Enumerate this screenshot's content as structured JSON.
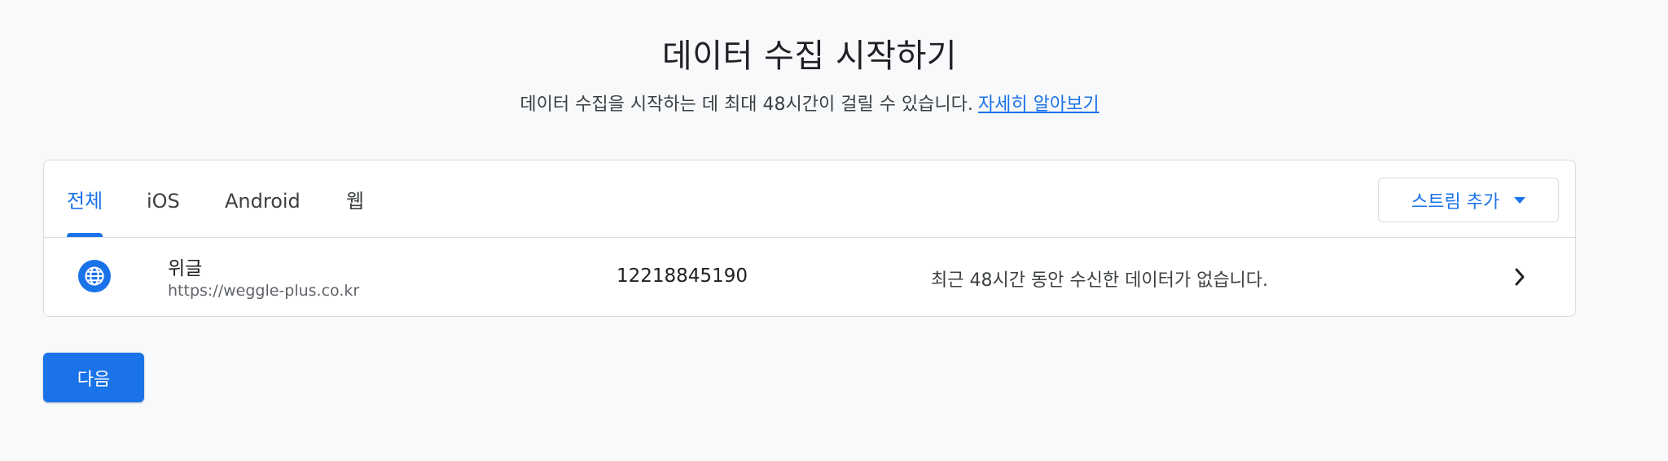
{
  "header": {
    "title": "데이터 수집 시작하기",
    "subtitle": "데이터 수집을 시작하는 데 최대 48시간이 걸릴 수 있습니다.",
    "learn_more": "자세히 알아보기"
  },
  "tabs": [
    {
      "label": "전체",
      "active": true
    },
    {
      "label": "iOS",
      "active": false
    },
    {
      "label": "Android",
      "active": false
    },
    {
      "label": "웹",
      "active": false
    }
  ],
  "add_stream": {
    "label": "스트림 추가",
    "icon": "arrow-drop-down-icon"
  },
  "streams": [
    {
      "icon": "globe-icon",
      "name": "위글",
      "url": "https://weggle-plus.co.kr",
      "id": "12218845190",
      "status": "최근 48시간 동안 수신한 데이터가 없습니다."
    }
  ],
  "next_button": {
    "label": "다음"
  },
  "colors": {
    "accent": "#1a73e8",
    "background": "#f8f9fa",
    "border": "#dadce0"
  }
}
